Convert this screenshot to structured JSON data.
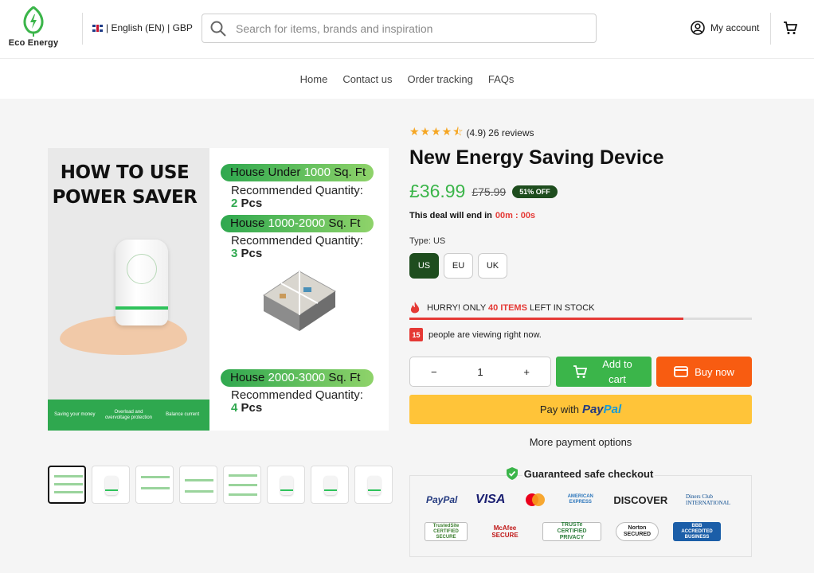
{
  "header": {
    "logo_text": "Eco Energy",
    "locale_text": "| English (EN) | GBP",
    "search_placeholder": "Search for items, brands and inspiration",
    "account_label": "My account"
  },
  "nav": {
    "items": [
      "Home",
      "Contact us",
      "Order tracking",
      "FAQs"
    ]
  },
  "gallery": {
    "main_image": {
      "title_line1": "HOW TO USE",
      "title_line2": "POWER SAVER",
      "device_label": "Electricity saving box",
      "tiers": [
        {
          "pill_pre": "House Under ",
          "pill_num": "1000",
          "pill_post": " Sq. Ft",
          "rec_label": "Recommended Quantity:",
          "qty": "2",
          "unit": " Pcs"
        },
        {
          "pill_pre": "House ",
          "pill_num": "1000-2000",
          "pill_post": " Sq. Ft",
          "rec_label": "Recommended Quantity:",
          "qty": "3",
          "unit": " Pcs"
        },
        {
          "pill_pre": "House ",
          "pill_num": "2000-3000",
          "pill_post": " Sq. Ft",
          "rec_label": "Recommended Quantity:",
          "qty": "4",
          "unit": " Pcs"
        }
      ],
      "features": [
        "Saving your money",
        "Overload and overvoltage protection",
        "Balance current"
      ]
    },
    "thumbnail_count": 8,
    "active_thumbnail": 0
  },
  "product": {
    "rating_value": "(4.9)",
    "stars": 4.5,
    "review_count": "26 reviews",
    "title": "New Energy Saving Device",
    "price": "£36.99",
    "old_price": "£75.99",
    "discount": "51% OFF",
    "deal_text": "This deal will end in",
    "deal_timer": "00m : 00s",
    "type_label": "Type: US",
    "variants": [
      "US",
      "EU",
      "UK"
    ],
    "selected_variant": "US",
    "stock_pre": "HURRY! ONLY ",
    "stock_count": "40 ITEMS",
    "stock_post": " LEFT IN STOCK",
    "stock_fraction": 0.8,
    "viewers": "15",
    "viewers_text": "people are viewing right now.",
    "quantity": "1",
    "qty_minus": "−",
    "qty_plus": "+",
    "add_to_cart": "Add to cart",
    "buy_now": "Buy now",
    "paypal_pre": "Pay with",
    "paypal_brand_1": "Pay",
    "paypal_brand_2": "Pal",
    "more_payment": "More payment options",
    "safe_checkout": "Guaranteed safe checkout"
  },
  "trust_logos": {
    "payments": [
      "PayPal",
      "VISA",
      "AMERICAN EXPRESS",
      "DISCOVER",
      "Diners Club INTERNATIONAL"
    ],
    "security": [
      "TrustedSite CERTIFIED SECURE",
      "McAfee SECURE",
      "TRUSTe CERTIFIED PRIVACY",
      "Norton SECURED",
      "BBB ACCREDITED BUSINESS"
    ]
  },
  "colors": {
    "brand_green": "#3bb54a",
    "dark_green": "#1e4d1e",
    "buy_orange": "#f85c11",
    "paypal_yellow": "#ffc439",
    "alert_red": "#e53935",
    "star": "#f5a623"
  }
}
